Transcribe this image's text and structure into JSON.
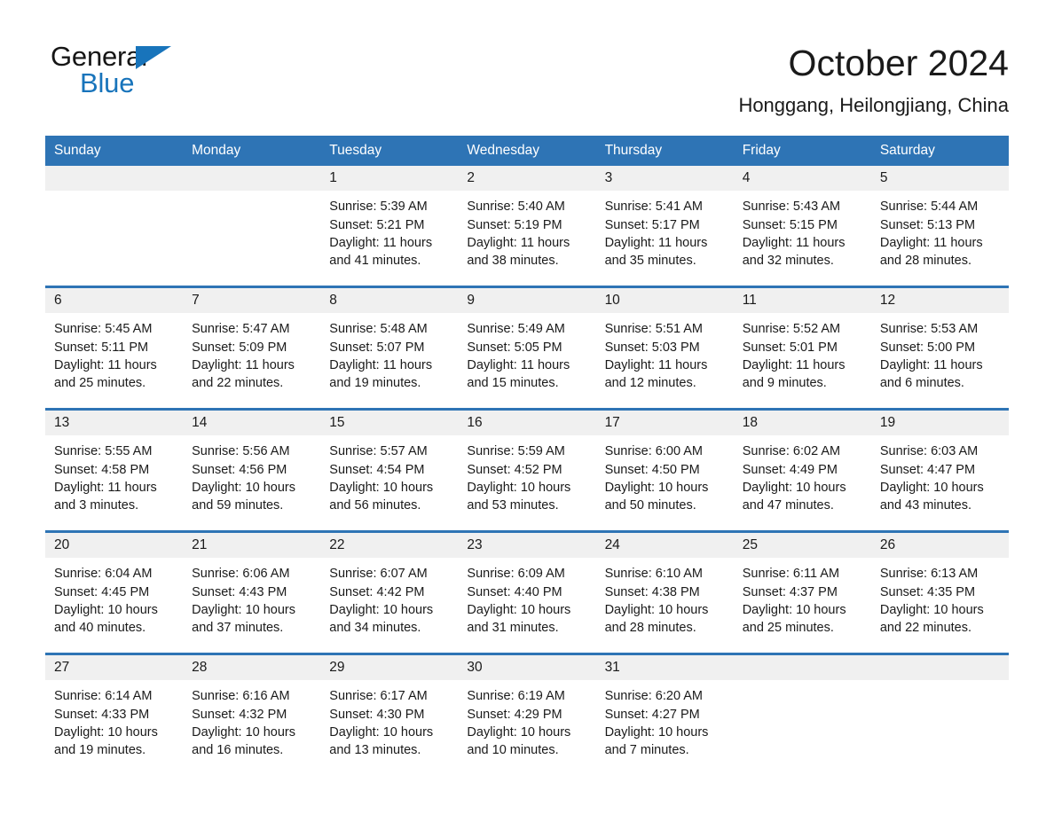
{
  "brand": {
    "name_part1": "General",
    "name_part2": "Blue",
    "triangle_color": "#1874bb",
    "icon": "triangle-logo-icon"
  },
  "header": {
    "month_title": "October 2024",
    "location": "Honggang, Heilongjiang, China"
  },
  "theme": {
    "header_blue": "#2e74b5",
    "row_divider_blue": "#2e74b5",
    "daynum_band": "#f0f0f0",
    "text": "#1a1a1a"
  },
  "weekdays": [
    "Sunday",
    "Monday",
    "Tuesday",
    "Wednesday",
    "Thursday",
    "Friday",
    "Saturday"
  ],
  "calendar": {
    "weeks": [
      [
        {
          "day": "",
          "sunrise": "",
          "sunset": "",
          "daylight_line1": "",
          "daylight_line2": ""
        },
        {
          "day": "",
          "sunrise": "",
          "sunset": "",
          "daylight_line1": "",
          "daylight_line2": ""
        },
        {
          "day": "1",
          "sunrise": "Sunrise: 5:39 AM",
          "sunset": "Sunset: 5:21 PM",
          "daylight_line1": "Daylight: 11 hours",
          "daylight_line2": "and 41 minutes."
        },
        {
          "day": "2",
          "sunrise": "Sunrise: 5:40 AM",
          "sunset": "Sunset: 5:19 PM",
          "daylight_line1": "Daylight: 11 hours",
          "daylight_line2": "and 38 minutes."
        },
        {
          "day": "3",
          "sunrise": "Sunrise: 5:41 AM",
          "sunset": "Sunset: 5:17 PM",
          "daylight_line1": "Daylight: 11 hours",
          "daylight_line2": "and 35 minutes."
        },
        {
          "day": "4",
          "sunrise": "Sunrise: 5:43 AM",
          "sunset": "Sunset: 5:15 PM",
          "daylight_line1": "Daylight: 11 hours",
          "daylight_line2": "and 32 minutes."
        },
        {
          "day": "5",
          "sunrise": "Sunrise: 5:44 AM",
          "sunset": "Sunset: 5:13 PM",
          "daylight_line1": "Daylight: 11 hours",
          "daylight_line2": "and 28 minutes."
        }
      ],
      [
        {
          "day": "6",
          "sunrise": "Sunrise: 5:45 AM",
          "sunset": "Sunset: 5:11 PM",
          "daylight_line1": "Daylight: 11 hours",
          "daylight_line2": "and 25 minutes."
        },
        {
          "day": "7",
          "sunrise": "Sunrise: 5:47 AM",
          "sunset": "Sunset: 5:09 PM",
          "daylight_line1": "Daylight: 11 hours",
          "daylight_line2": "and 22 minutes."
        },
        {
          "day": "8",
          "sunrise": "Sunrise: 5:48 AM",
          "sunset": "Sunset: 5:07 PM",
          "daylight_line1": "Daylight: 11 hours",
          "daylight_line2": "and 19 minutes."
        },
        {
          "day": "9",
          "sunrise": "Sunrise: 5:49 AM",
          "sunset": "Sunset: 5:05 PM",
          "daylight_line1": "Daylight: 11 hours",
          "daylight_line2": "and 15 minutes."
        },
        {
          "day": "10",
          "sunrise": "Sunrise: 5:51 AM",
          "sunset": "Sunset: 5:03 PM",
          "daylight_line1": "Daylight: 11 hours",
          "daylight_line2": "and 12 minutes."
        },
        {
          "day": "11",
          "sunrise": "Sunrise: 5:52 AM",
          "sunset": "Sunset: 5:01 PM",
          "daylight_line1": "Daylight: 11 hours",
          "daylight_line2": "and 9 minutes."
        },
        {
          "day": "12",
          "sunrise": "Sunrise: 5:53 AM",
          "sunset": "Sunset: 5:00 PM",
          "daylight_line1": "Daylight: 11 hours",
          "daylight_line2": "and 6 minutes."
        }
      ],
      [
        {
          "day": "13",
          "sunrise": "Sunrise: 5:55 AM",
          "sunset": "Sunset: 4:58 PM",
          "daylight_line1": "Daylight: 11 hours",
          "daylight_line2": "and 3 minutes."
        },
        {
          "day": "14",
          "sunrise": "Sunrise: 5:56 AM",
          "sunset": "Sunset: 4:56 PM",
          "daylight_line1": "Daylight: 10 hours",
          "daylight_line2": "and 59 minutes."
        },
        {
          "day": "15",
          "sunrise": "Sunrise: 5:57 AM",
          "sunset": "Sunset: 4:54 PM",
          "daylight_line1": "Daylight: 10 hours",
          "daylight_line2": "and 56 minutes."
        },
        {
          "day": "16",
          "sunrise": "Sunrise: 5:59 AM",
          "sunset": "Sunset: 4:52 PM",
          "daylight_line1": "Daylight: 10 hours",
          "daylight_line2": "and 53 minutes."
        },
        {
          "day": "17",
          "sunrise": "Sunrise: 6:00 AM",
          "sunset": "Sunset: 4:50 PM",
          "daylight_line1": "Daylight: 10 hours",
          "daylight_line2": "and 50 minutes."
        },
        {
          "day": "18",
          "sunrise": "Sunrise: 6:02 AM",
          "sunset": "Sunset: 4:49 PM",
          "daylight_line1": "Daylight: 10 hours",
          "daylight_line2": "and 47 minutes."
        },
        {
          "day": "19",
          "sunrise": "Sunrise: 6:03 AM",
          "sunset": "Sunset: 4:47 PM",
          "daylight_line1": "Daylight: 10 hours",
          "daylight_line2": "and 43 minutes."
        }
      ],
      [
        {
          "day": "20",
          "sunrise": "Sunrise: 6:04 AM",
          "sunset": "Sunset: 4:45 PM",
          "daylight_line1": "Daylight: 10 hours",
          "daylight_line2": "and 40 minutes."
        },
        {
          "day": "21",
          "sunrise": "Sunrise: 6:06 AM",
          "sunset": "Sunset: 4:43 PM",
          "daylight_line1": "Daylight: 10 hours",
          "daylight_line2": "and 37 minutes."
        },
        {
          "day": "22",
          "sunrise": "Sunrise: 6:07 AM",
          "sunset": "Sunset: 4:42 PM",
          "daylight_line1": "Daylight: 10 hours",
          "daylight_line2": "and 34 minutes."
        },
        {
          "day": "23",
          "sunrise": "Sunrise: 6:09 AM",
          "sunset": "Sunset: 4:40 PM",
          "daylight_line1": "Daylight: 10 hours",
          "daylight_line2": "and 31 minutes."
        },
        {
          "day": "24",
          "sunrise": "Sunrise: 6:10 AM",
          "sunset": "Sunset: 4:38 PM",
          "daylight_line1": "Daylight: 10 hours",
          "daylight_line2": "and 28 minutes."
        },
        {
          "day": "25",
          "sunrise": "Sunrise: 6:11 AM",
          "sunset": "Sunset: 4:37 PM",
          "daylight_line1": "Daylight: 10 hours",
          "daylight_line2": "and 25 minutes."
        },
        {
          "day": "26",
          "sunrise": "Sunrise: 6:13 AM",
          "sunset": "Sunset: 4:35 PM",
          "daylight_line1": "Daylight: 10 hours",
          "daylight_line2": "and 22 minutes."
        }
      ],
      [
        {
          "day": "27",
          "sunrise": "Sunrise: 6:14 AM",
          "sunset": "Sunset: 4:33 PM",
          "daylight_line1": "Daylight: 10 hours",
          "daylight_line2": "and 19 minutes."
        },
        {
          "day": "28",
          "sunrise": "Sunrise: 6:16 AM",
          "sunset": "Sunset: 4:32 PM",
          "daylight_line1": "Daylight: 10 hours",
          "daylight_line2": "and 16 minutes."
        },
        {
          "day": "29",
          "sunrise": "Sunrise: 6:17 AM",
          "sunset": "Sunset: 4:30 PM",
          "daylight_line1": "Daylight: 10 hours",
          "daylight_line2": "and 13 minutes."
        },
        {
          "day": "30",
          "sunrise": "Sunrise: 6:19 AM",
          "sunset": "Sunset: 4:29 PM",
          "daylight_line1": "Daylight: 10 hours",
          "daylight_line2": "and 10 minutes."
        },
        {
          "day": "31",
          "sunrise": "Sunrise: 6:20 AM",
          "sunset": "Sunset: 4:27 PM",
          "daylight_line1": "Daylight: 10 hours",
          "daylight_line2": "and 7 minutes."
        },
        {
          "day": "",
          "sunrise": "",
          "sunset": "",
          "daylight_line1": "",
          "daylight_line2": ""
        },
        {
          "day": "",
          "sunrise": "",
          "sunset": "",
          "daylight_line1": "",
          "daylight_line2": ""
        }
      ]
    ]
  }
}
